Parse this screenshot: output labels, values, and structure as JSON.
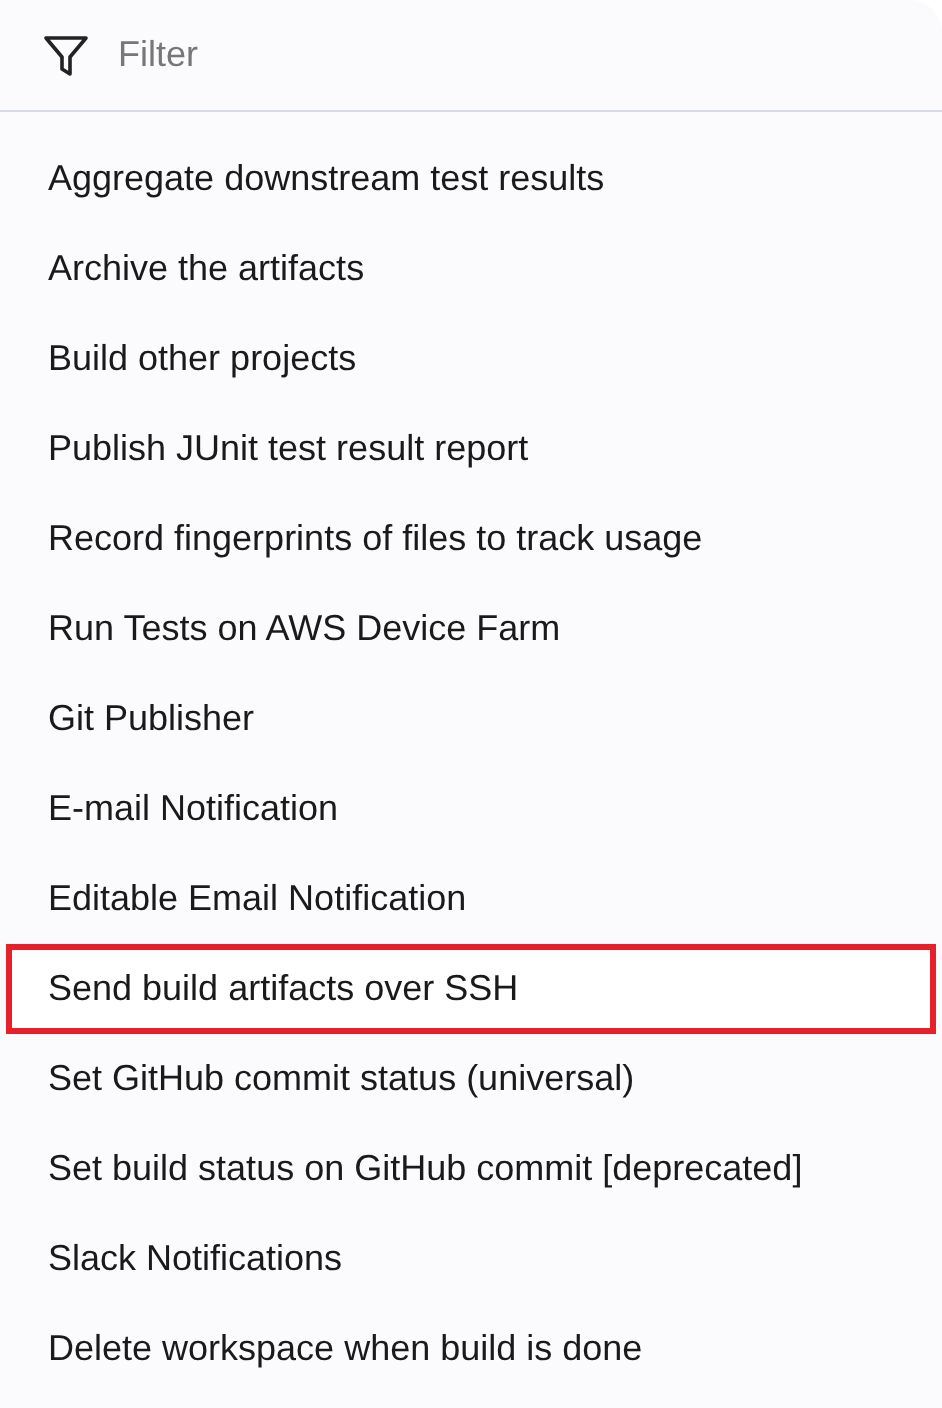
{
  "filter": {
    "placeholder": "Filter"
  },
  "items": [
    {
      "label": "Aggregate downstream test results",
      "highlighted": false
    },
    {
      "label": "Archive the artifacts",
      "highlighted": false
    },
    {
      "label": "Build other projects",
      "highlighted": false
    },
    {
      "label": "Publish JUnit test result report",
      "highlighted": false
    },
    {
      "label": "Record fingerprints of files to track usage",
      "highlighted": false
    },
    {
      "label": "Run Tests on AWS Device Farm",
      "highlighted": false
    },
    {
      "label": "Git Publisher",
      "highlighted": false
    },
    {
      "label": "E-mail Notification",
      "highlighted": false
    },
    {
      "label": "Editable Email Notification",
      "highlighted": false
    },
    {
      "label": "Send build artifacts over SSH",
      "highlighted": true
    },
    {
      "label": "Set GitHub commit status (universal)",
      "highlighted": false
    },
    {
      "label": "Set build status on GitHub commit [deprecated]",
      "highlighted": false
    },
    {
      "label": "Slack Notifications",
      "highlighted": false
    },
    {
      "label": "Delete workspace when build is done",
      "highlighted": false
    }
  ]
}
